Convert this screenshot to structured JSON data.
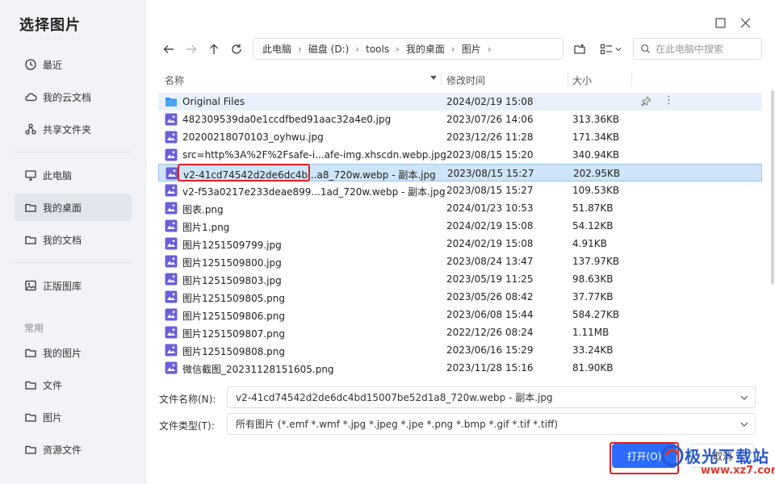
{
  "title": "选择图片",
  "sidebar": {
    "items": [
      {
        "label": "最近",
        "icon": "clock-icon"
      },
      {
        "label": "我的云文档",
        "icon": "cloud-icon"
      },
      {
        "label": "共享文件夹",
        "icon": "share-icon"
      },
      {
        "label": "此电脑",
        "icon": "monitor-icon"
      },
      {
        "label": "我的桌面",
        "icon": "folder-icon"
      },
      {
        "label": "我的文档",
        "icon": "folder-icon"
      },
      {
        "label": "正版图库",
        "icon": "image-icon"
      }
    ],
    "section": "常用",
    "common": [
      {
        "label": "我的图片",
        "icon": "folder-icon"
      },
      {
        "label": "文件",
        "icon": "folder-icon"
      },
      {
        "label": "图片",
        "icon": "folder-icon"
      },
      {
        "label": "资源文件",
        "icon": "folder-icon"
      }
    ]
  },
  "breadcrumb": [
    "此电脑",
    "磁盘 (D:)",
    "tools",
    "我的桌面",
    "图片"
  ],
  "search": {
    "placeholder": "在此电脑中搜索"
  },
  "columns": {
    "name": "名称",
    "date": "修改时间",
    "size": "大小"
  },
  "files": [
    {
      "name": "Original Files",
      "date": "2024/02/19 15:08",
      "size": "",
      "type": "folder"
    },
    {
      "name": "482309539da0e1ccdfbed91aac32a4e0.jpg",
      "date": "2023/07/26 14:06",
      "size": "313.36KB",
      "type": "image"
    },
    {
      "name": "20200218070103_oyhwu.jpg",
      "date": "2023/12/26 11:28",
      "size": "171.34KB",
      "type": "image"
    },
    {
      "name": "src=http%3A%2F%2Fsafe-i...afe-img.xhscdn.webp.jpg",
      "date": "2023/08/15 15:20",
      "size": "340.94KB",
      "type": "image"
    },
    {
      "name": "v2-41cd74542d2de6dc4b...a8_720w.webp - 副本.jpg",
      "date": "2023/08/15 15:27",
      "size": "202.95KB",
      "type": "image"
    },
    {
      "name": "v2-f53a0217e233deae899...1ad_720w.webp - 副本.jpg",
      "date": "2023/08/15 15:27",
      "size": "109.53KB",
      "type": "image"
    },
    {
      "name": "图表.png",
      "date": "2024/01/23 10:53",
      "size": "51.87KB",
      "type": "image"
    },
    {
      "name": "图片1.png",
      "date": "2024/02/19 15:08",
      "size": "54.12KB",
      "type": "image"
    },
    {
      "name": "图片1251509799.jpg",
      "date": "2024/02/19 15:08",
      "size": "4.91KB",
      "type": "image"
    },
    {
      "name": "图片1251509800.jpg",
      "date": "2023/08/24 13:47",
      "size": "137.97KB",
      "type": "image"
    },
    {
      "name": "图片1251509803.jpg",
      "date": "2023/05/19 11:25",
      "size": "98.63KB",
      "type": "image"
    },
    {
      "name": "图片1251509805.png",
      "date": "2023/05/26 08:42",
      "size": "37.77KB",
      "type": "image"
    },
    {
      "name": "图片1251509806.png",
      "date": "2023/06/08 15:44",
      "size": "584.27KB",
      "type": "image"
    },
    {
      "name": "图片1251509807.png",
      "date": "2022/12/26 08:24",
      "size": "1.11MB",
      "type": "image"
    },
    {
      "name": "图片1251509808.png",
      "date": "2023/06/16 15:29",
      "size": "33.24KB",
      "type": "image"
    },
    {
      "name": "微信截图_20231128151605.png",
      "date": "2023/11/28 15:16",
      "size": "81.90KB",
      "type": "image"
    }
  ],
  "filename": {
    "label": "文件名称(N):",
    "value": "v2-41cd74542d2de6dc4bd15007be52d1a8_720w.webp - 副本.jpg"
  },
  "filetype": {
    "label": "文件类型(T):",
    "value": "所有图片 (*.emf *.wmf *.jpg *.jpeg *.jpe *.png *.bmp *.gif *.tif *.tiff)"
  },
  "buttons": {
    "open": "打开(O)",
    "cancel": "取消"
  },
  "watermark": {
    "text": "极光下载站",
    "url": "www.xz7.com"
  },
  "colors": {
    "accent": "#2a6cff",
    "folder": "#2f8df0",
    "image_icon": "#6a5fd8",
    "selection": "#cfe4f8",
    "annotation": "#e02020"
  }
}
